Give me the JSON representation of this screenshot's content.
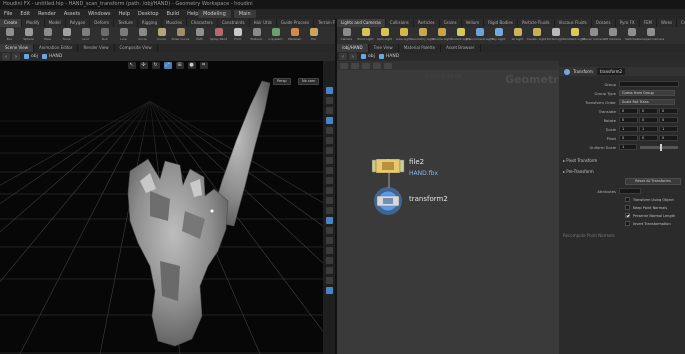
{
  "window": {
    "title": "Houdini FX - untitled.hip - HAND_scan_transform (path: /obj/HAND) - Geometry Workspace - houdini"
  },
  "menubar": {
    "items": [
      "File",
      "Edit",
      "Render",
      "Assets",
      "Windows",
      "Help",
      "Desktop",
      "Build",
      "Help"
    ],
    "workspace": "Build",
    "right_tabs": [
      "Modeling",
      "Main"
    ]
  },
  "shelf_tabs_left": [
    "Create",
    "Modify",
    "Model",
    "Polygon",
    "Deform",
    "Texture",
    "Rigging",
    "Muscles",
    "Characters",
    "Constraints",
    "Hair Utils",
    "Guide Process",
    "Terrain FX"
  ],
  "shelf_tabs_right": [
    "Lights and Cameras",
    "Collisions",
    "Particles",
    "Grains",
    "Vellum",
    "Rigid Bodies",
    "Particle Fluids",
    "Viscous Fluids",
    "Oceans",
    "Pyro FX",
    "FEM",
    "Wires",
    "Crowds",
    "Drive Simulation"
  ],
  "shelf_left_tools": [
    {
      "label": "Box",
      "color": "#8f8f8f"
    },
    {
      "label": "Sphere",
      "color": "#9a9a9a"
    },
    {
      "label": "Tube",
      "color": "#8c8c8c"
    },
    {
      "label": "Torus",
      "color": "#a2a2a2"
    },
    {
      "label": "Grid",
      "color": "#7e7e7e"
    },
    {
      "label": "Null",
      "color": "#6c6c6c"
    },
    {
      "label": "Line",
      "color": "#7b7b7b"
    },
    {
      "label": "Circle",
      "color": "#8a8a8a"
    },
    {
      "label": "Curve",
      "color": "#b3a57a"
    },
    {
      "label": "Draw Curve",
      "color": "#9c8f6b"
    },
    {
      "label": "Path",
      "color": "#8f8f8f"
    },
    {
      "label": "Spray Paint",
      "color": "#b46a6a"
    },
    {
      "label": "Font",
      "color": "#c9c9c9"
    },
    {
      "label": "Platonic",
      "color": "#8a8a8a"
    },
    {
      "label": "L-System",
      "color": "#6aa06a"
    },
    {
      "label": "Metaball",
      "color": "#d08a50"
    },
    {
      "label": "File",
      "color": "#caa65c"
    }
  ],
  "shelf_right_tools": [
    {
      "label": "Camera",
      "color": "#8a8a8a"
    },
    {
      "label": "Point Light",
      "color": "#d8c35a"
    },
    {
      "label": "Spot Light",
      "color": "#d8c35a"
    },
    {
      "label": "Area Light",
      "color": "#d3b84c"
    },
    {
      "label": "Geometry Light",
      "color": "#c9a94c"
    },
    {
      "label": "Volume Light",
      "color": "#c8a449"
    },
    {
      "label": "Distant Light",
      "color": "#d9c65e"
    },
    {
      "label": "Environment Light",
      "color": "#6fa2d6"
    },
    {
      "label": "Sky Light",
      "color": "#74a8db"
    },
    {
      "label": "GI Light",
      "color": "#cdb45a"
    },
    {
      "label": "Caustic Light",
      "color": "#c8b058"
    },
    {
      "label": "Portal Light",
      "color": "#b9b9b9"
    },
    {
      "label": "Ambient Light",
      "color": "#d9c860"
    },
    {
      "label": "Stereo Camera",
      "color": "#8e8e8e"
    },
    {
      "label": "VR Camera",
      "color": "#8e8e8e"
    },
    {
      "label": "Switcher",
      "color": "#8e8e8e"
    },
    {
      "label": "Gamepad Camera",
      "color": "#8e8e8e"
    }
  ],
  "pane_tabs_left": [
    "Scene View",
    "Animation Editor",
    "Render View",
    "Composite View"
  ],
  "pane_tabs_right": [
    "/obj/HAND",
    "Tree View",
    "Material Palette",
    "Asset Browser"
  ],
  "viewport": {
    "path": "obj",
    "object": "HAND",
    "persp_label": "Persp",
    "cam_label": "No cam"
  },
  "network": {
    "path": "obj",
    "object": "HAND",
    "context_label": "Geometry",
    "watermark_small": "Indie Edition",
    "nodes": [
      {
        "name": "file2",
        "sub": "HAND.fbx"
      },
      {
        "name": "transform2",
        "sub": ""
      }
    ]
  },
  "params": {
    "node_type": "Transform",
    "node_name": "transform2",
    "group_label": "Group",
    "group_value": "",
    "rows": [
      {
        "label": "Group Type",
        "value": "Guess from Group",
        "kind": "dd"
      },
      {
        "label": "Transform Order",
        "value": "Scale Rot Trans",
        "kind": "dd"
      },
      {
        "label": "Translate",
        "value": "0",
        "kind": "fld"
      },
      {
        "label": "Rotate",
        "value": "0",
        "kind": "fld"
      },
      {
        "label": "Scale",
        "value": "1",
        "kind": "fld"
      },
      {
        "label": "Pivot",
        "value": "0",
        "kind": "fld"
      },
      {
        "label": "Uniform Scale",
        "value": "1",
        "kind": "fld"
      }
    ],
    "folders": [
      "Pivot Transform",
      "Pre-Transform"
    ],
    "reset_button": "Reset All Transforms",
    "attributes_label": "Attributes",
    "checkboxes": [
      {
        "label": "Transform Using Object",
        "checked": false
      },
      {
        "label": "Keep Point Normals",
        "checked": false
      },
      {
        "label": "Preserve Normal Length",
        "checked": true
      },
      {
        "label": "Invert Transformation",
        "checked": false
      }
    ],
    "footer_label": "Recompute Point Normals"
  }
}
